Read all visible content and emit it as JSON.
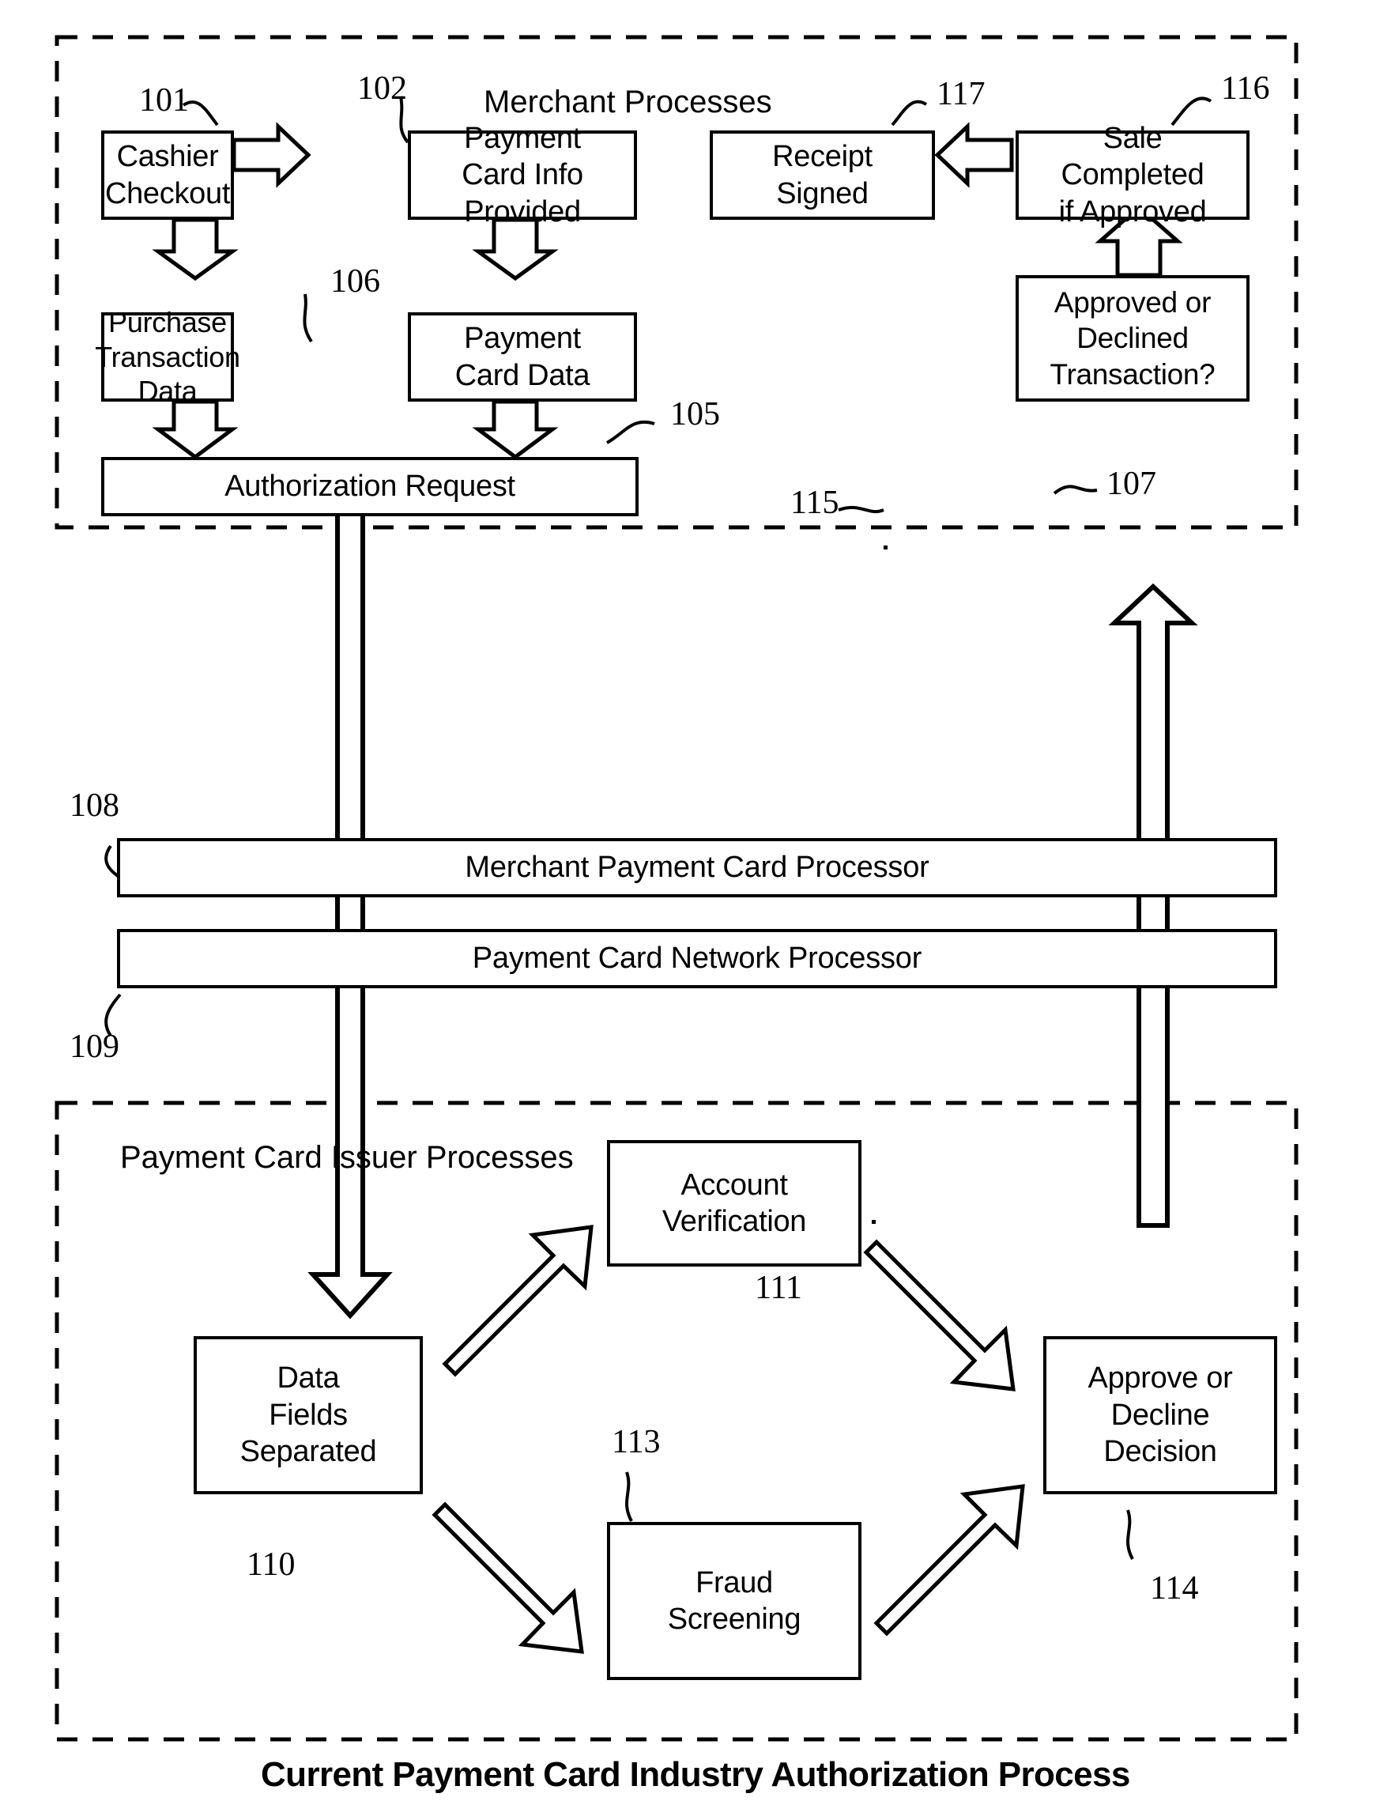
{
  "figure": {
    "caption": "Current Payment Card Industry Authorization Process",
    "groups": {
      "merchant": {
        "label": "Merchant Processes"
      },
      "issuer": {
        "label": "Payment\nCard Issuer\nProcesses",
        "line1": "Payment",
        "line2": "Card Issuer",
        "line3": "Processes"
      }
    }
  },
  "boxes": {
    "cashier_checkout": {
      "ref": "101",
      "line1": "Cashier",
      "line2": "Checkout"
    },
    "payment_card_info": {
      "ref": "102",
      "line1": "Payment",
      "line2": "Card Info",
      "line3": "Provided"
    },
    "receipt_signed": {
      "ref": "117",
      "line1": "Receipt",
      "line2": "Signed"
    },
    "sale_completed": {
      "ref": "116",
      "line1": "Sale",
      "line2": "Completed",
      "line3": "if Approved"
    },
    "purchase_transaction_data": {
      "ref": "106",
      "line1": "Purchase",
      "line2": "Transaction",
      "line3": "Data"
    },
    "payment_card_data": {
      "ref": "105",
      "line1": "Payment",
      "line2": "Card Data"
    },
    "approved_declined": {
      "ref": "115",
      "line1": "Approved or",
      "line2": "Declined",
      "line3": "Transaction?"
    },
    "authorization_request": {
      "ref": "107",
      "label": "Authorization Request"
    },
    "merchant_processor": {
      "ref": "108",
      "label": "Merchant Payment Card Processor"
    },
    "network_processor": {
      "ref": "109",
      "label": "Payment Card Network Processor"
    },
    "data_fields_separated": {
      "ref": "110",
      "line1": "Data",
      "line2": "Fields",
      "line3": "Separated"
    },
    "account_verification": {
      "ref": "111",
      "line1": "Account",
      "line2": "Verification"
    },
    "fraud_screening": {
      "ref": "113",
      "line1": "Fraud",
      "line2": "Screening"
    },
    "approve_decline_decision": {
      "ref": "114",
      "line1": "Approve or",
      "line2": "Decline",
      "line3": "Decision"
    }
  },
  "colors": {
    "ink": "#000000",
    "paper": "#ffffff"
  }
}
